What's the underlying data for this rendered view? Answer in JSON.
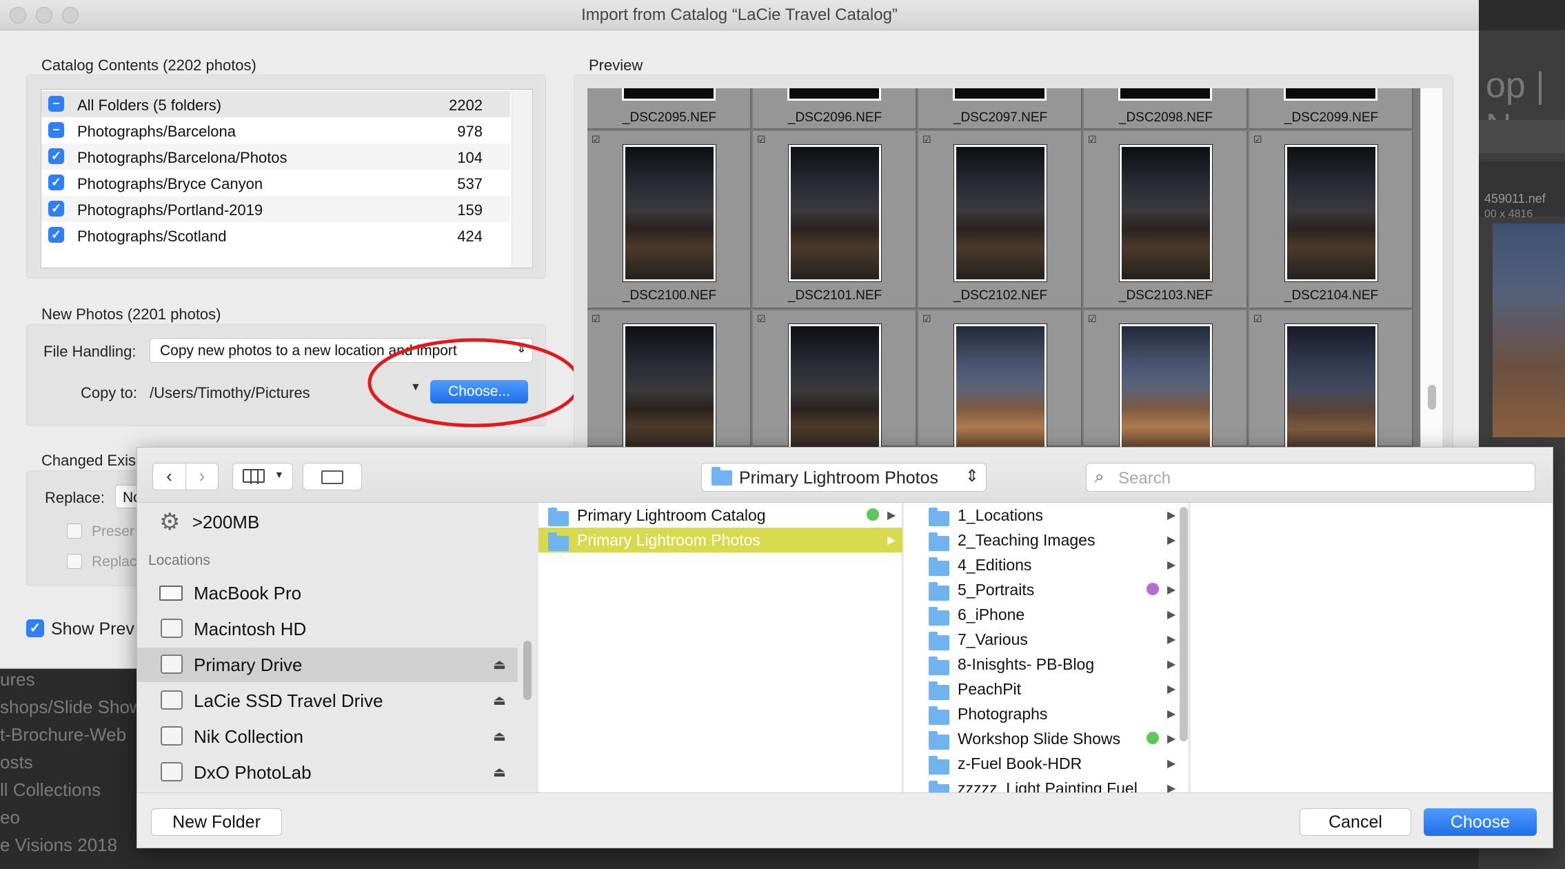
{
  "window": {
    "title": "Import from Catalog “LaCie Travel Catalog”"
  },
  "background": {
    "top_right_text": "op  |  N",
    "file_info": "459011.nef",
    "file_dims": "00 x 4816",
    "left_items": [
      "ures",
      "shops/Slide Show",
      "t-Brochure-Web",
      "osts",
      "ll Collections",
      "eo",
      "e Visions 2018"
    ]
  },
  "catalog": {
    "label": "Catalog Contents (2202 photos)",
    "rows": [
      {
        "name": "All Folders (5 folders)",
        "count": "2202",
        "check": "−"
      },
      {
        "name": "Photographs/Barcelona",
        "count": "978",
        "check": "−"
      },
      {
        "name": "Photographs/Barcelona/Photos",
        "count": "104",
        "check": "✓"
      },
      {
        "name": "Photographs/Bryce Canyon",
        "count": "537",
        "check": "✓"
      },
      {
        "name": "Photographs/Portland-2019",
        "count": "159",
        "check": "✓"
      },
      {
        "name": "Photographs/Scotland",
        "count": "424",
        "check": "✓"
      }
    ]
  },
  "new_photos": {
    "label": "New Photos (2201 photos)",
    "file_handling_label": "File Handling:",
    "file_handling_value": "Copy new photos to a new location and import",
    "copy_to_label": "Copy to:",
    "copy_to_path": "/Users/Timothy/Pictures",
    "choose_label": "Choose..."
  },
  "changed": {
    "label": "Changed Exis",
    "replace_label": "Replace:",
    "replace_value": "No",
    "preserve_label": "Preser",
    "replace_opt_label": "Replac"
  },
  "show_preview_label": "Show Prev",
  "preview": {
    "label": "Preview",
    "rows": [
      [
        "_DSC2095.NEF",
        "_DSC2096.NEF",
        "_DSC2097.NEF",
        "_DSC2098.NEF",
        "_DSC2099.NEF"
      ],
      [
        "_DSC2100.NEF",
        "_DSC2101.NEF",
        "_DSC2102.NEF",
        "_DSC2103.NEF",
        "_DSC2104.NEF"
      ]
    ]
  },
  "chooser": {
    "location_popup": "Primary Lightroom Photos",
    "search_placeholder": "Search",
    "sidebar_top_item": ">200MB",
    "locations_label": "Locations",
    "locations": [
      {
        "name": "MacBook Pro",
        "eject": false
      },
      {
        "name": "Macintosh HD",
        "eject": false
      },
      {
        "name": "Primary Drive",
        "eject": true
      },
      {
        "name": "LaCie SSD Travel Drive",
        "eject": true
      },
      {
        "name": "Nik Collection",
        "eject": true
      },
      {
        "name": "DxO PhotoLab",
        "eject": true
      }
    ],
    "column1": [
      {
        "name": "Primary Lightroom Catalog",
        "tag": "#5cc85a"
      },
      {
        "name": "Primary Lightroom Photos",
        "tag": ""
      }
    ],
    "column2": [
      {
        "name": " 1_Locations",
        "tag": ""
      },
      {
        "name": "2_Teaching Images",
        "tag": ""
      },
      {
        "name": "4_Editions",
        "tag": ""
      },
      {
        "name": "5_Portraits",
        "tag": "#b56ad8"
      },
      {
        "name": "6_iPhone",
        "tag": ""
      },
      {
        "name": "7_Various",
        "tag": ""
      },
      {
        "name": "8-Inisghts- PB-Blog",
        "tag": ""
      },
      {
        "name": "PeachPit",
        "tag": ""
      },
      {
        "name": "Photographs",
        "tag": ""
      },
      {
        "name": "Workshop Slide Shows",
        "tag": "#5cc85a"
      },
      {
        "name": "z-Fuel Book-HDR",
        "tag": ""
      },
      {
        "name": "zzzzz_Light Painting Fuel",
        "tag": ""
      }
    ],
    "new_folder_label": "New Folder",
    "cancel_label": "Cancel",
    "choose_label": "Choose"
  },
  "colors": {
    "accent": "#2f7ff5",
    "selection": "#d7da4c",
    "annotation": "#e3191c"
  }
}
